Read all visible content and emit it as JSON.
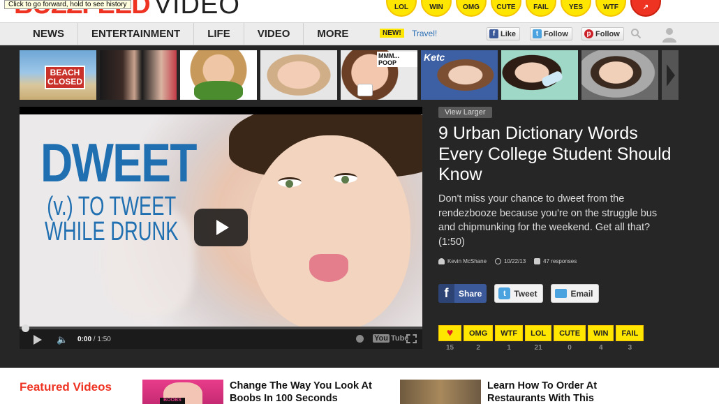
{
  "tooltip": "Click to go forward, hold to see history",
  "logo": {
    "text": "BUZZFEED",
    "suffix": "VIDEO"
  },
  "header_badges": [
    "LOL",
    "WIN",
    "OMG",
    "CUTE",
    "FAIL",
    "YES",
    "WTF"
  ],
  "nav": {
    "items": [
      "NEWS",
      "ENTERTAINMENT",
      "LIFE",
      "VIDEO",
      "MORE"
    ],
    "new_badge": "NEW!",
    "travel_link": "Travel!",
    "fb_like": "Like",
    "tw_follow": "Follow",
    "pin_follow": "Follow"
  },
  "thumbnails": [
    {
      "label": "BEACH CLOSED"
    },
    {
      "label": ""
    },
    {
      "label": ""
    },
    {
      "label": ""
    },
    {
      "label": "MMM... POOP"
    },
    {
      "label": "Ketc"
    },
    {
      "label": ""
    },
    {
      "label": ""
    }
  ],
  "video": {
    "overlay_title": "DWEET",
    "overlay_sub1": "(v.) TO TWEET",
    "overlay_sub2": "WHILE DRUNK",
    "current_time": "0:00",
    "duration": "/ 1:50",
    "yt_text": "You",
    "yt_tube": "Tube",
    "progress": 0.0
  },
  "article": {
    "view_larger": "View Larger",
    "title": "9 Urban Dictionary Words Every College Student Should Know",
    "description": "Don't miss your chance to dweet from the rendezbooze because you're on the struggle bus and chipmunking for the weekend. Get all that? (1:50)",
    "author": "Kevin McShane",
    "date": "10/22/13",
    "responses": "47 responses",
    "share_label": "Share",
    "tweet_label": "Tweet",
    "email_label": "Email"
  },
  "reactions": [
    {
      "label": "♥",
      "count": "15"
    },
    {
      "label": "OMG",
      "count": "2"
    },
    {
      "label": "WTF",
      "count": "1"
    },
    {
      "label": "LOL",
      "count": "21"
    },
    {
      "label": "CUTE",
      "count": "0"
    },
    {
      "label": "WIN",
      "count": "4"
    },
    {
      "label": "FAIL",
      "count": "3"
    }
  ],
  "featured": {
    "title": "Featured Videos",
    "items": [
      {
        "title": "Change The Way You Look At Boobs In 100 Seconds",
        "thumb_label": "BOOBS"
      },
      {
        "title": "Learn How To Order At Restaurants With This"
      }
    ]
  },
  "colors": {
    "accent": "#ee3322",
    "badge_yellow": "#ffe600",
    "dark_bg": "#262626",
    "link_blue": "#2b6fb6"
  }
}
